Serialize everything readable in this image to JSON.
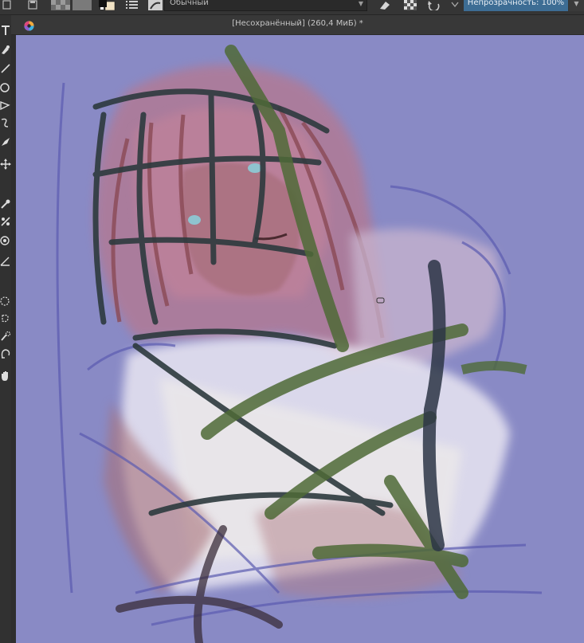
{
  "toolbar": {
    "blend_mode": "Обычный",
    "opacity_label": "Непрозрачность: 100%"
  },
  "document": {
    "title": "[Несохранённый]  (260,4 МиБ) *"
  },
  "tools": [
    "text-tool-icon",
    "pen-tool-icon",
    "line-tool-icon",
    "ellipse-tool-icon",
    "polygon-tool-icon",
    "freehand-path-icon",
    "dynamic-brush-icon",
    "move-tool-icon",
    "eyedropper-icon",
    "smart-patch-icon",
    "assistant-tool-icon",
    "measure-tool-icon",
    "ellipse-select-icon",
    "freehand-select-icon",
    "similar-select-icon",
    "magnetic-select-icon",
    "pan-hand-icon"
  ],
  "colors": {
    "canvas_bg": "#8d8ec6",
    "accent": "#3d6d94"
  }
}
